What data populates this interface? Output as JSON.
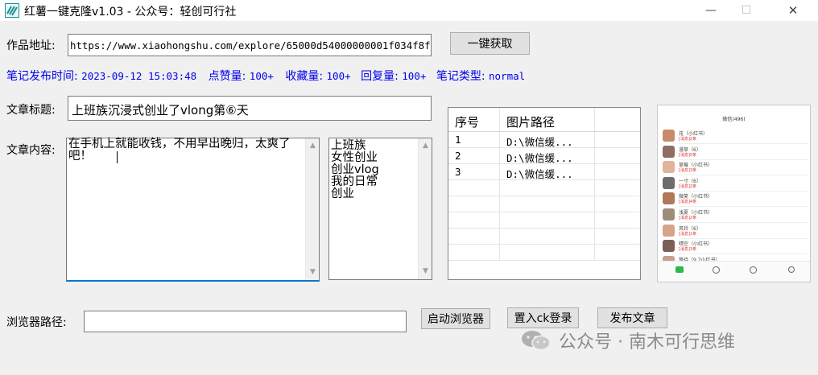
{
  "window": {
    "title": "红薯一键克隆v1.03 - 公众号：轻创可行社",
    "minimize_glyph": "—",
    "maximize_glyph": "☐",
    "close_glyph": "✕"
  },
  "form": {
    "url_label": "作品地址:",
    "url_value": "https://www.xiaohongshu.com/explore/65000d54000000001f034f8f",
    "fetch_button": "一键获取",
    "info": {
      "publish_time_label": "笔记发布时间:",
      "publish_time_value": "2023-09-12 15:03:48",
      "likes_label": "点赞量:",
      "likes_value": "100+",
      "favorites_label": "收藏量:",
      "favorites_value": "100+",
      "replies_label": "回复量:",
      "replies_value": "100+",
      "type_label": "笔记类型:",
      "type_value": "normal"
    },
    "title_label": "文章标题:",
    "title_value": "上班族沉浸式创业了vlong第⑥天",
    "content_label": "文章内容:",
    "content_value": "在手机上就能收钱，不用早出晚归，太爽了吧！",
    "tags": [
      "上班族",
      "女性创业",
      "创业vlog",
      "我的日常",
      "创业"
    ]
  },
  "image_table": {
    "headers": [
      "序号",
      "图片路径"
    ],
    "rows": [
      {
        "index": "1",
        "path": "D:\\微信缓..."
      },
      {
        "index": "2",
        "path": "D:\\微信缓..."
      },
      {
        "index": "3",
        "path": "D:\\微信缓..."
      }
    ]
  },
  "preview": {
    "header": "微信(496)",
    "chats": [
      {
        "name": "花（小红书）",
        "sub": "[消息]2条"
      },
      {
        "name": "漫草（6）",
        "sub": "[消息]5条"
      },
      {
        "name": "草莓（小红书）",
        "sub": "[消息]3条"
      },
      {
        "name": "一寸（6）",
        "sub": "[消息]2条"
      },
      {
        "name": "微笑（小红书）",
        "sub": "[消息]4条"
      },
      {
        "name": "浅夏（小红书）",
        "sub": "[消息]2条"
      },
      {
        "name": "风铃（6）",
        "sub": "[消息]1条"
      },
      {
        "name": "晴空（小红书）",
        "sub": "[消息]3条"
      },
      {
        "name": "等待（9.7小红书）",
        "sub": "[消息]2条"
      }
    ],
    "avatar_colors": [
      "#c98a6b",
      "#8d6e63",
      "#e0b49a",
      "#6d6d6d",
      "#b07a5a",
      "#9e8c7a",
      "#d4a58a",
      "#7b5e57",
      "#c2a18e"
    ]
  },
  "browser": {
    "path_label": "浏览器路径:",
    "path_value": "",
    "start_button": "启动浏览器",
    "cookie_button": "置入ck登录",
    "publish_button": "发布文章"
  },
  "watermark": {
    "text": "公众号 · 南木可行思维"
  },
  "colors": {
    "info_text": "#0000ee",
    "focus_underline": "#0078d7",
    "window_bg": "#f0f0f0",
    "app_icon": "#1a8f8f"
  }
}
